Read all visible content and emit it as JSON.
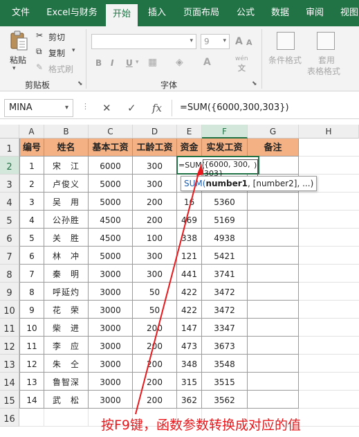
{
  "tabs": [
    "文件",
    "Excel与财务",
    "开始",
    "插入",
    "页面布局",
    "公式",
    "数据",
    "审阅",
    "视图"
  ],
  "ribbon": {
    "paste_label": "粘贴",
    "cut_label": "剪切",
    "copy_label": "复制",
    "format_painter_label": "格式刷",
    "clipboard_group": "剪贴板",
    "font_size": "9",
    "grow_font": "A",
    "shrink_font": "A",
    "bold": "B",
    "italic": "I",
    "underline": "U",
    "phonetic": "wén",
    "font_group": "字体",
    "conditional_format_label": "条件格式",
    "table_format_label_1": "套用",
    "table_format_label_2": "表格格式"
  },
  "formula_bar": {
    "name_box": "MINA",
    "cancel": "✕",
    "enter": "✓",
    "fx": "fx",
    "formula": "=SUM({6000,300,303})"
  },
  "columns": [
    "A",
    "B",
    "C",
    "D",
    "E",
    "F",
    "G",
    "H"
  ],
  "rows": [
    "1",
    "2",
    "3",
    "4",
    "5",
    "6",
    "7",
    "8",
    "9",
    "10",
    "11",
    "12",
    "13",
    "14",
    "15",
    "16"
  ],
  "table": {
    "headers": [
      "编号",
      "姓名",
      "基本工资",
      "工龄工资",
      "资金",
      "实发工资",
      "备注"
    ],
    "data": [
      [
        "1",
        "宋　江",
        "6000",
        "300",
        "",
        "",
        ""
      ],
      [
        "2",
        "卢俊义",
        "5000",
        "300",
        "",
        "",
        ""
      ],
      [
        "3",
        "吴　用",
        "5000",
        "200",
        "16",
        "5360",
        ""
      ],
      [
        "4",
        "公孙胜",
        "4500",
        "200",
        "469",
        "5169",
        ""
      ],
      [
        "5",
        "关　胜",
        "4500",
        "100",
        "338",
        "4938",
        ""
      ],
      [
        "6",
        "林　冲",
        "5000",
        "300",
        "121",
        "5421",
        ""
      ],
      [
        "7",
        "秦　明",
        "3000",
        "300",
        "441",
        "3741",
        ""
      ],
      [
        "8",
        "呼延灼",
        "3000",
        "50",
        "422",
        "3472",
        ""
      ],
      [
        "9",
        "花　荣",
        "3000",
        "50",
        "422",
        "3472",
        ""
      ],
      [
        "10",
        "柴　进",
        "3000",
        "200",
        "147",
        "3347",
        ""
      ],
      [
        "11",
        "李　应",
        "3000",
        "200",
        "473",
        "3673",
        ""
      ],
      [
        "12",
        "朱　仝",
        "3000",
        "200",
        "348",
        "3548",
        ""
      ],
      [
        "13",
        "鲁智深",
        "3000",
        "200",
        "315",
        "3515",
        ""
      ],
      [
        "14",
        "武　松",
        "3000",
        "200",
        "362",
        "3562",
        ""
      ]
    ]
  },
  "edit_cell": {
    "prefix": "=SUM(",
    "highlight": "{6000, 300, 303}",
    "suffix": ")"
  },
  "tooltip": {
    "fn": "SUM(",
    "arg1": "number1",
    "rest": ", [number2], ...)"
  },
  "annotation": "按F9键，函数参数转换成对应的值",
  "colors": {
    "excel_green": "#217346",
    "header_fill": "#f4b183",
    "annotation": "#e8181c"
  }
}
